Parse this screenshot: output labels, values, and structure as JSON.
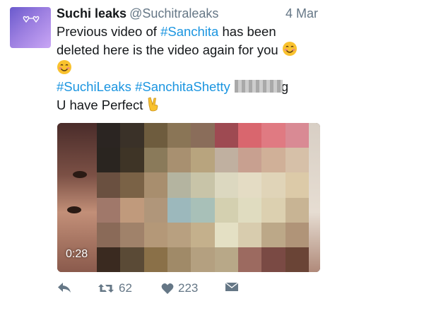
{
  "tweet": {
    "display_name": "Suchi leaks",
    "handle": "@Suchitraleaks",
    "timestamp": "4 Mar",
    "line1_pre": "Previous video of ",
    "line1_tag": "#Sanchita",
    "line1_post": " has been deleted here is the video again for you ",
    "hashtag1": "#SuchiLeaks",
    "hashtag2": "#SanchitaShetty",
    "clipped_tail": "g",
    "line3": "U have Perfect ",
    "video_duration": "0:28"
  },
  "actions": {
    "retweets": "62",
    "likes": "223"
  },
  "icons": {
    "avatar_glasses": "heart-glasses-icon",
    "smile": "smiling-face-emoji",
    "victory": "victory-hand-emoji",
    "reply": "reply-icon",
    "retweet": "retweet-icon",
    "like": "heart-icon",
    "dm": "envelope-icon"
  },
  "colors": {
    "hashtag": "#1b95e0",
    "secondary_text": "#657786"
  }
}
